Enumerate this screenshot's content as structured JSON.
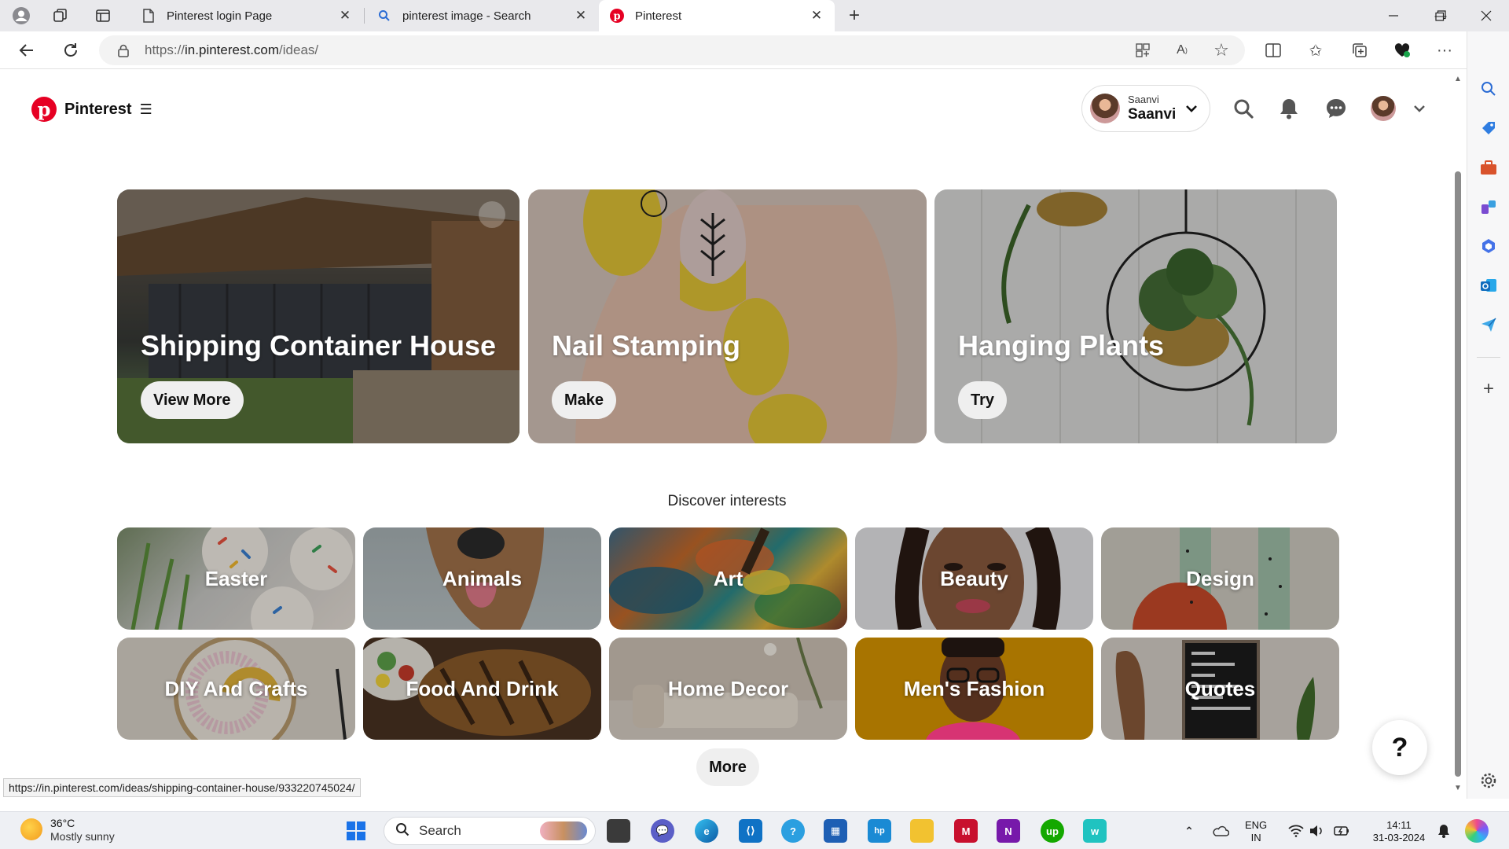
{
  "browser": {
    "tabs": [
      {
        "title": "Pinterest login Page",
        "icon": "page-icon",
        "active": false
      },
      {
        "title": "pinterest image - Search",
        "icon": "search-icon",
        "active": false
      },
      {
        "title": "Pinterest",
        "icon": "pinterest-logo-icon",
        "active": true
      }
    ],
    "url_prefix": "https://",
    "url_host": "in.pinterest.com",
    "url_path": "/ideas/",
    "status_url": "https://in.pinterest.com/ideas/shipping-container-house/933220745024/"
  },
  "header": {
    "brand": "Pinterest",
    "account_small": "Saanvi",
    "account_big": "Saanvi"
  },
  "hero_cards": [
    {
      "title": "Shipping Container House",
      "button": "View More"
    },
    {
      "title": "Nail Stamping",
      "button": "Make"
    },
    {
      "title": "Hanging Plants",
      "button": "Try"
    }
  ],
  "discover_heading": "Discover interests",
  "interests": [
    {
      "label": "Easter"
    },
    {
      "label": "Animals"
    },
    {
      "label": "Art"
    },
    {
      "label": "Beauty"
    },
    {
      "label": "Design"
    },
    {
      "label": "DIY And Crafts"
    },
    {
      "label": "Food And Drink"
    },
    {
      "label": "Home Decor"
    },
    {
      "label": "Men's Fashion"
    },
    {
      "label": "Quotes"
    }
  ],
  "more_button": "More",
  "help_button": "?",
  "taskbar": {
    "temperature": "36°C",
    "condition": "Mostly sunny",
    "search_label": "Search",
    "lang_top": "ENG",
    "lang_bottom": "IN",
    "time": "14:11",
    "date": "31-03-2024"
  },
  "colors": {
    "pinterest_red": "#e60023",
    "mens_fashion_tile": "#b17b00",
    "hero_button_bg": "#efefef"
  }
}
